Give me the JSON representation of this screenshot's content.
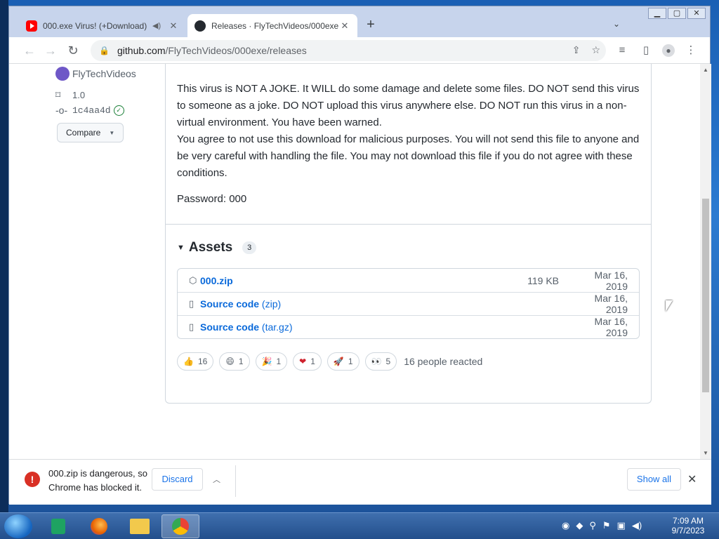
{
  "tabs": [
    {
      "title": "000.exe Virus! (+Download)",
      "icon": "youtube-icon",
      "active": false
    },
    {
      "title": "Releases · FlyTechVideos/000exe",
      "icon": "github-icon",
      "active": true
    }
  ],
  "address": {
    "host": "github.com",
    "path": "/FlyTechVideos/000exe/releases"
  },
  "release": {
    "author": "FlyTechVideos",
    "tag": "1.0",
    "commit": "1c4aa4d",
    "compare_label": "Compare",
    "paragraphs": [
      "This virus is NOT A JOKE. It WILL do some damage and delete some files. DO NOT send this virus to someone as a joke. DO NOT upload this virus anywhere else. DO NOT run this virus in a non-virtual environment. You have been warned.",
      "You agree to not use this download for malicious purposes. You will not send this file to anyone and be very careful with handling the file. You may not download this file if you do not agree with these conditions."
    ],
    "password": "Password: 000",
    "assets_title": "Assets",
    "assets_count": "3",
    "assets": [
      {
        "name": "000.zip",
        "ext": "",
        "size": "119 KB",
        "date": "Mar 16, 2019",
        "icon": "package-icon"
      },
      {
        "name": "Source code",
        "ext": "(zip)",
        "size": "",
        "date": "Mar 16, 2019",
        "icon": "file-zip-icon"
      },
      {
        "name": "Source code",
        "ext": "(tar.gz)",
        "size": "",
        "date": "Mar 16, 2019",
        "icon": "file-zip-icon"
      }
    ],
    "reactions": [
      {
        "emoji": "👍",
        "count": "16",
        "name": "thumbs-up"
      },
      {
        "emoji": "😄",
        "count": "1",
        "name": "laugh"
      },
      {
        "emoji": "🎉",
        "count": "1",
        "name": "hooray"
      },
      {
        "emoji": "❤",
        "count": "1",
        "name": "heart"
      },
      {
        "emoji": "🚀",
        "count": "1",
        "name": "rocket"
      },
      {
        "emoji": "👀",
        "count": "5",
        "name": "eyes"
      }
    ],
    "reacted_text": "16 people reacted"
  },
  "download": {
    "message": "000.zip is dangerous, so Chrome has blocked it.",
    "discard_label": "Discard",
    "show_all_label": "Show all"
  },
  "taskbar": {
    "time": "7:09 AM",
    "date": "9/7/2023"
  }
}
